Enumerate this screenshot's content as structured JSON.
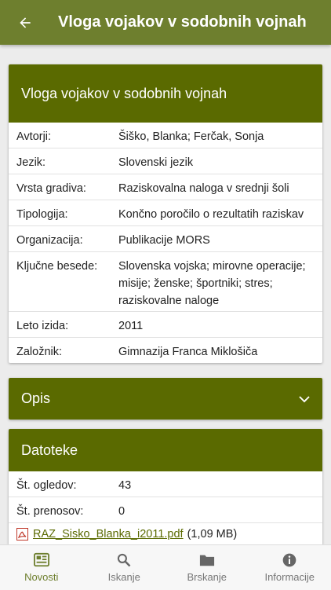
{
  "appbar": {
    "title": "Vloga vojakov v sodobnih vojnah",
    "back_icon": "arrow-left-icon"
  },
  "details": {
    "title": "Vloga vojakov v sodobnih vojnah",
    "rows": [
      {
        "label": "Avtorji:",
        "value": "Šiško, Blanka; Ferčak, Sonja"
      },
      {
        "label": "Jezik:",
        "value": "Slovenski jezik"
      },
      {
        "label": "Vrsta gradiva:",
        "value": "Raziskovalna naloga v srednji šoli"
      },
      {
        "label": "Tipologija:",
        "value": "Končno poročilo o rezultatih raziskav"
      },
      {
        "label": "Organizacija:",
        "value": "Publikacije MORS"
      },
      {
        "label": "Ključne besede:",
        "value": "Slovenska vojska; mirovne operacije; misije; ženske; športniki; stres; raziskovalne naloge"
      },
      {
        "label": "Leto izida:",
        "value": "2011"
      },
      {
        "label": "Založnik:",
        "value": "Gimnazija Franca Miklošiča"
      }
    ]
  },
  "opis": {
    "title": "Opis",
    "expand_icon": "chevron-down-icon"
  },
  "datoteke": {
    "title": "Datoteke",
    "rows": [
      {
        "label": "Št. ogledov:",
        "value": "43"
      },
      {
        "label": "Št. prenosov:",
        "value": "0"
      }
    ],
    "file": {
      "name": "RAZ_Sisko_Blanka_i2011.pdf",
      "size": "(1,09 MB)",
      "icon": "pdf-icon"
    }
  },
  "bottom_nav": [
    {
      "label": "Novosti",
      "icon": "news-icon",
      "active": true
    },
    {
      "label": "Iskanje",
      "icon": "search-icon",
      "active": false
    },
    {
      "label": "Brskanje",
      "icon": "folder-icon",
      "active": false
    },
    {
      "label": "Informacije",
      "icon": "info-icon",
      "active": false
    }
  ],
  "colors": {
    "appbar": "#6e7f2e",
    "card_header": "#5a6a00",
    "active_nav": "#6e7f2e"
  }
}
